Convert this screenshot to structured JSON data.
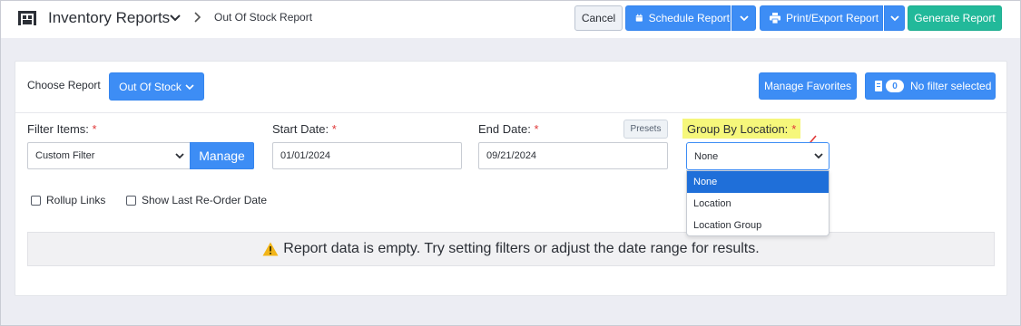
{
  "header": {
    "app_icon": "warehouse-icon",
    "title": "Inventory Reports",
    "breadcrumb": "Out Of Stock Report",
    "buttons": {
      "cancel": "Cancel",
      "schedule": "Schedule Report",
      "print": "Print/Export Report",
      "generate": "Generate Report"
    }
  },
  "report_bar": {
    "choose_label": "Choose Report",
    "selected_report": "Out Of Stock",
    "manage_favorites": "Manage Favorites",
    "filter_count": "0",
    "filter_status": "No filter selected"
  },
  "filters": {
    "filter_items": {
      "label": "Filter Items:",
      "required": "*",
      "value": "Custom Filter",
      "manage": "Manage"
    },
    "start_date": {
      "label": "Start Date:",
      "required": "*",
      "value": "01/01/2024"
    },
    "end_date": {
      "label": "End Date:",
      "required": "*",
      "value": "09/21/2024"
    },
    "presets": "Presets",
    "group_by": {
      "label": "Group By Location:",
      "required": "*",
      "value": "None",
      "options": [
        "None",
        "Location",
        "Location Group"
      ],
      "selected_index": 0
    }
  },
  "options": {
    "rollup_links": {
      "label": "Rollup Links",
      "checked": false
    },
    "show_reorder": {
      "label": "Show Last Re-Order Date",
      "checked": false
    }
  },
  "empty_message": "Report data is empty. Try setting filters or adjust the date range for results.",
  "colors": {
    "primary": "#3d8df5",
    "success": "#22b99a",
    "highlight": "#f6f77b",
    "selected_option": "#1f6fd9",
    "warning": "#f2b518",
    "required": "#e03838"
  }
}
